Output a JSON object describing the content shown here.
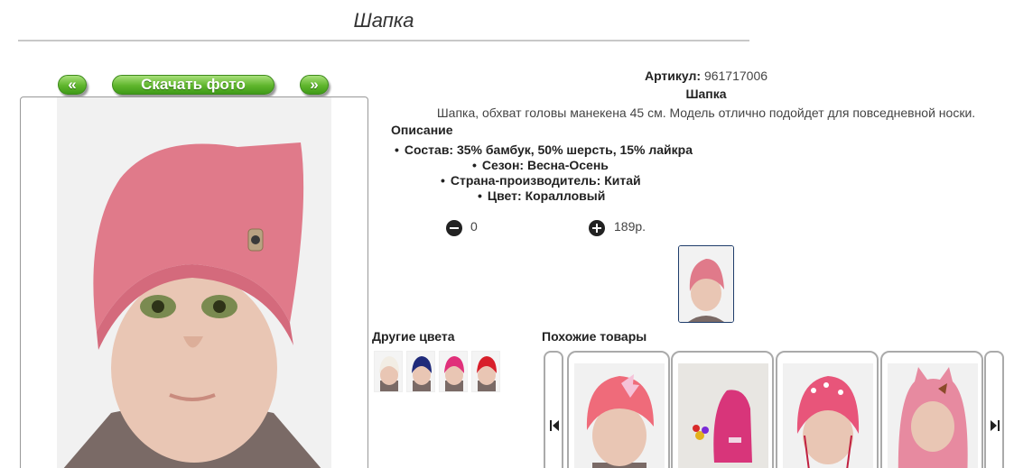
{
  "page": {
    "title": "Шапка"
  },
  "gallery": {
    "prev_label": "«",
    "download_label": "Скачать фото",
    "next_label": "»"
  },
  "product": {
    "article_label": "Артикул:",
    "article_value": "961717006",
    "name": "Шапка",
    "description": "Шапка, обхват головы манекена 45 см. Модель отлично подойдет для повседневной носки.",
    "description_heading": "Описание",
    "specs": [
      "Состав: 35% бамбук, 50% шерсть, 15% лайкра",
      "Сезон: Весна-Осень",
      "Страна-производитель: Китай",
      "Цвет: Коралловый"
    ],
    "quantity": "0",
    "price": "189р.",
    "hat_color": "#e07a8a"
  },
  "other_colors": {
    "title": "Другие цвета",
    "swatches": [
      "#f2ede4",
      "#1f2a7a",
      "#e0307a",
      "#d81f2a"
    ]
  },
  "similar": {
    "title": "Похожие товары",
    "items": [
      {
        "name": "pink-hat-bow",
        "color": "#ef6b7a"
      },
      {
        "name": "pink-beanie-stand",
        "color": "#d8357a"
      },
      {
        "name": "pink-hat-ties",
        "color": "#e8557a"
      },
      {
        "name": "pink-balaclava",
        "color": "#e78aa0"
      }
    ]
  }
}
